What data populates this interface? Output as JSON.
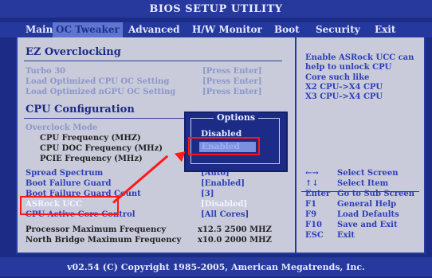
{
  "window_title": "BIOS SETUP UTILITY",
  "menu": [
    {
      "label": "Main",
      "active": false
    },
    {
      "label": "OC Tweaker",
      "active": true
    },
    {
      "label": "Advanced",
      "active": false
    },
    {
      "label": "H/W Monitor",
      "active": false
    },
    {
      "label": "Boot",
      "active": false
    },
    {
      "label": "Security",
      "active": false
    },
    {
      "label": "Exit",
      "active": false
    }
  ],
  "ez_title": "EZ Overclocking",
  "ez_items": [
    {
      "label": "Turbo 30",
      "value": "[Press Enter]"
    },
    {
      "label": "Load Optimized CPU OC Setting",
      "value": "[Press Enter]"
    },
    {
      "label": "Load Optimized nGPU OC Setting",
      "value": "[Press Enter]"
    }
  ],
  "cpu_title": "CPU Configuration",
  "cpu_items": [
    {
      "label": "Overclock Mode"
    },
    {
      "label": "CPU Frequency (MHZ)"
    },
    {
      "label": "CPU DOC Frequency (MHz)"
    },
    {
      "label": "PCIE Frequency (MHz)"
    }
  ],
  "settings": [
    {
      "label": "Spread Spectrum",
      "value": "[Auto]"
    },
    {
      "label": "Boot Failure Guard",
      "value": "[Enabled]"
    },
    {
      "label": "Boot Failure Guard Count",
      "value": "[3]"
    },
    {
      "label": "ASRock UCC",
      "value": "[Disabled]"
    },
    {
      "label": "CPU Active Core Control",
      "value": "[All Cores]"
    }
  ],
  "info": [
    {
      "label": "Processor Maximum Frequency",
      "value": "x12.5 2500 MHZ"
    },
    {
      "label": "North Bridge Maximum Frequency",
      "value": "x10.0 2000 MHZ"
    }
  ],
  "help_lines": [
    "Enable ASRock UCC can",
    "help to unlock CPU",
    "Core such like",
    "X2 CPU->X4 CPU",
    "X3 CPU->X4 CPU"
  ],
  "keys": [
    {
      "key": "←→",
      "desc": "Select Screen"
    },
    {
      "key": "↑↓",
      "desc": "Select Item"
    },
    {
      "key": "Enter",
      "desc": "Go to Sub Screen"
    },
    {
      "key": "F1",
      "desc": "General Help"
    },
    {
      "key": "F9",
      "desc": "Load Defaults"
    },
    {
      "key": "F10",
      "desc": "Save and Exit"
    },
    {
      "key": "ESC",
      "desc": "Exit"
    }
  ],
  "popup": {
    "title": "Options",
    "options": [
      {
        "label": "Disabled",
        "selected": false
      },
      {
        "label": "Enabled",
        "selected": true
      }
    ]
  },
  "footer": "v02.54 (C) Copyright 1985-2005, American Megatrends, Inc.",
  "colors": {
    "annotation": "#ff1515",
    "bios_blue": "#1c2c86",
    "panel_gray": "#c9cbdb"
  }
}
